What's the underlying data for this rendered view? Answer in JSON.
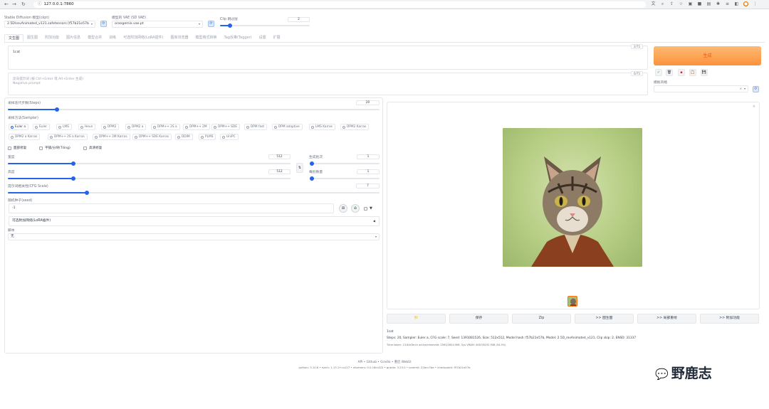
{
  "browser": {
    "url": "127.0.0.1:7860",
    "back_icon": "back-arrow-icon",
    "forward_icon": "forward-arrow-icon",
    "reload_icon": "reload-icon"
  },
  "top": {
    "checkpoint_label": "Stable Diffusion 模型(ckpt)",
    "checkpoint_value": "2.5D\\revAnimated_v121.safetensors [f57b21e57b",
    "vae_label": "模型的 VAE (SD VAE)",
    "vae_value": "orangemix.vae.pt",
    "clip_label": "Clip 跳过层",
    "clip_value": "2"
  },
  "tabs": [
    "文生图",
    "图生图",
    "附加功能",
    "图片信息",
    "模型合并",
    "训练",
    "可选附加网络(LoRA插件)",
    "图库浏览器",
    "模型格式转换",
    "Tag反推(Tagger)",
    "设置",
    "扩展"
  ],
  "prompt": {
    "value": "1cat",
    "counter": "2/75",
    "negative_placeholder_1": "反向提示词 (按 Ctrl+Enter 或 Alt+Enter 生成)",
    "negative_placeholder_2": "Negative prompt",
    "negative_counter": "0/75"
  },
  "actions": {
    "generate_label": "生成",
    "style_label": "模板风格"
  },
  "params": {
    "steps_label": "采样迭代步数(Steps)",
    "steps_value": "20",
    "sampler_label": "采样方法(Sampler)",
    "samplers_row1": [
      "Euler a",
      "Euler",
      "LMS",
      "Heun",
      "DPM2",
      "DPM2 a",
      "DPM++ 2S a",
      "DPM++ 2M",
      "DPM++ SDE",
      "DPM fast",
      "DPM adaptive",
      "LMS Karras",
      "DPM2 Karras"
    ],
    "samplers_row2": [
      "DPM2 a Karras",
      "DPM++ 2S a Karras",
      "DPM++ 2M Karras",
      "DPM++ SDE Karras",
      "DDIM",
      "PLMS",
      "UniPC"
    ],
    "restore_faces": "面部修复",
    "tiling": "平铺/分块(Tiling)",
    "hires_fix": "高清修复",
    "width_label": "宽度",
    "width_value": "512",
    "height_label": "高度",
    "height_value": "512",
    "batch_count_label": "生成批次",
    "batch_count_value": "1",
    "batch_size_label": "每批数量",
    "batch_size_value": "1",
    "cfg_label": "提示词相关性(CFG Scale)",
    "cfg_value": "7",
    "seed_label": "随机种子(seed)",
    "seed_value": "-1",
    "addnet_label": "可选附加网络(LoRA插件)",
    "script_label": "脚本",
    "script_value": "无"
  },
  "output": {
    "buttons": [
      "📁",
      "保存",
      "Zip",
      ">> 图生图",
      ">> 局部重绘",
      ">> 附加功能"
    ],
    "info_prompt": "1cat",
    "info_params": "Steps: 20, Sampler: Euler a, CFG scale: 7, Seed: 1391081526, Size: 512x512, Model hash: f57b21e57b, Model: 2.5D_revAnimated_v121, Clip skip: 2, ENSD: 31337",
    "info_time": "Time taken: 13.64sTorch active/reserved: 2563/2654 MiB, Sys VRAM: 4467/8192 MiB (54.5%)"
  },
  "footer": {
    "links": "API  •  Github  •  Gradio  •  重启 WebUI",
    "versions": "python: 3.10.8  •  torch: 1.13.1+cu117  •  xformers: 0.0.16rc425  •  gradio: 3.23.0  •  commit: 22bcc7be  •  checkpoint: f57b21e57b"
  },
  "watermark": "野鹿志",
  "colors": {
    "accent": "#2563eb",
    "generate": "#fb923c"
  }
}
